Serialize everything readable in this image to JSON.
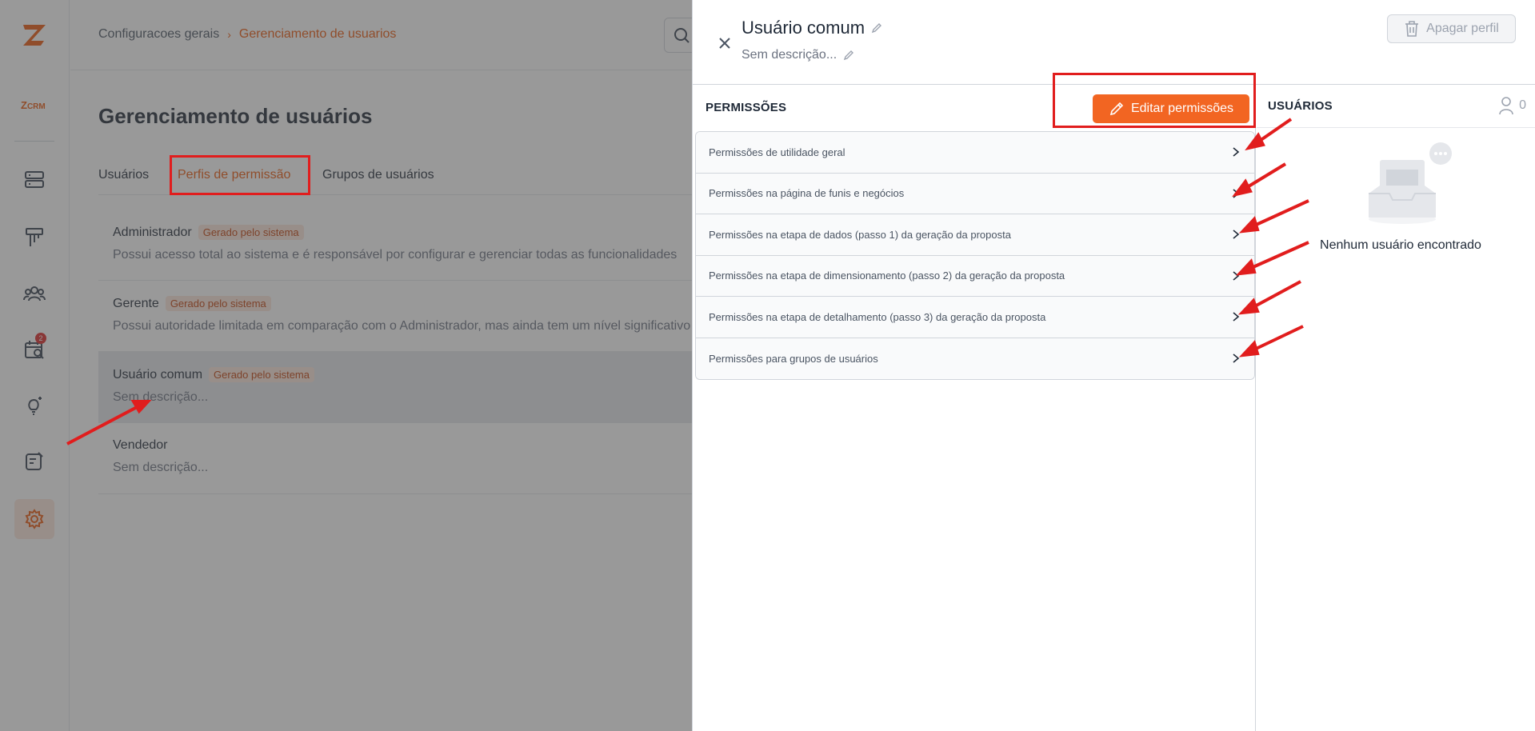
{
  "sidebar": {
    "logo_sub": "CRM",
    "logo_z": "Z",
    "items": [
      {
        "name": "servers",
        "icon": "server-icon"
      },
      {
        "name": "funnels",
        "icon": "funnel-icon"
      },
      {
        "name": "people",
        "icon": "users-icon"
      },
      {
        "name": "calendar-search",
        "icon": "calendar-search-icon",
        "badge": "2"
      },
      {
        "name": "ideas",
        "icon": "lightbulb-icon"
      },
      {
        "name": "notes",
        "icon": "note-edit-icon"
      },
      {
        "name": "settings",
        "icon": "gear-icon",
        "active": true
      }
    ]
  },
  "breadcrumb": {
    "parent": "Configuracoes gerais",
    "separator": "›",
    "current": "Gerenciamento de usuarios"
  },
  "page": {
    "title": "Gerenciamento de usuários",
    "tabs": [
      {
        "label": "Usuários",
        "active": false
      },
      {
        "label": "Perfis de permissão",
        "active": true
      },
      {
        "label": "Grupos de usuários",
        "active": false
      }
    ],
    "profiles": [
      {
        "name": "Administrador",
        "badge": "Gerado pelo sistema",
        "description": "Possui acesso total ao sistema e é responsável por configurar e gerenciar todas as funcionalidades"
      },
      {
        "name": "Gerente",
        "badge": "Gerado pelo sistema",
        "description": "Possui autoridade limitada em comparação com o Administrador, mas ainda tem um nível significativo"
      },
      {
        "name": "Usuário comum",
        "badge": "Gerado pelo sistema",
        "description": "Sem descrição...",
        "selected": true
      },
      {
        "name": "Vendedor",
        "badge": "",
        "description": "Sem descrição..."
      }
    ]
  },
  "drawer": {
    "title": "Usuário comum",
    "subtitle": "Sem descrição...",
    "delete_label": "Apagar perfil",
    "permissions_title": "PERMISSÕES",
    "edit_label": "Editar permissões",
    "permissions": [
      "Permissões de utilidade geral",
      "Permissões na página de funis e negócios",
      "Permissões na etapa de dados (passo 1) da geração da proposta",
      "Permissões na etapa de dimensionamento (passo 2) da geração da proposta",
      "Permissões na etapa de detalhamento (passo 3) da geração da proposta",
      "Permissões para grupos de usuários"
    ],
    "users_title": "USUÁRIOS",
    "users_count": "0",
    "empty_text": "Nenhum usuário encontrado"
  },
  "colors": {
    "accent": "#f26522",
    "annotation": "#e11d1d"
  }
}
